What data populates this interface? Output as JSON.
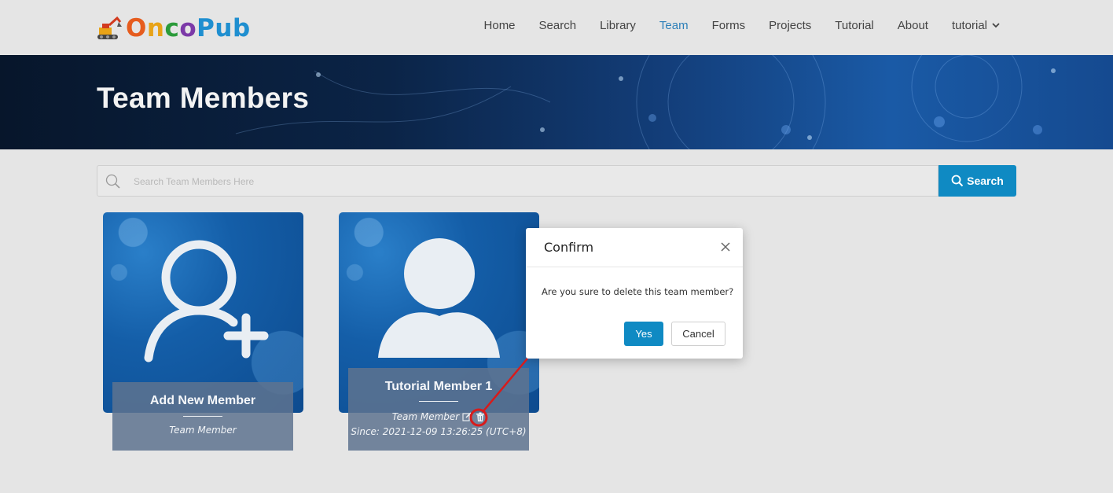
{
  "brand": {
    "name_parts": [
      "O",
      "n",
      "c",
      "o",
      "P",
      "u",
      "b"
    ],
    "colors": [
      "#e65c1e",
      "#e8a317",
      "#2b9b3a",
      "#7c3aa8",
      "#1f8fd0",
      "#1f8fd0",
      "#1f8fd0"
    ]
  },
  "nav": {
    "items": [
      "Home",
      "Search",
      "Library",
      "Team",
      "Forms",
      "Projects",
      "Tutorial",
      "About"
    ],
    "active": "Team",
    "user": "tutorial"
  },
  "banner": {
    "title": "Team Members"
  },
  "search": {
    "placeholder": "Search Team Members Here",
    "value": "",
    "button_label": "Search"
  },
  "cards": [
    {
      "name": "Add New Member",
      "role": "Team Member",
      "icon": "add-user-icon"
    },
    {
      "name": "Tutorial Member 1",
      "role": "Team Member",
      "since": "Since: 2021-12-09 13:26:25 (UTC+8)",
      "icon": "user-icon"
    }
  ],
  "modal": {
    "title": "Confirm",
    "message": "Are you sure to delete this team member?",
    "yes_label": "Yes",
    "cancel_label": "Cancel"
  },
  "colors": {
    "accent": "#0f8ac3",
    "active_nav": "#2c7fb8",
    "annotation": "#d81b1b"
  }
}
